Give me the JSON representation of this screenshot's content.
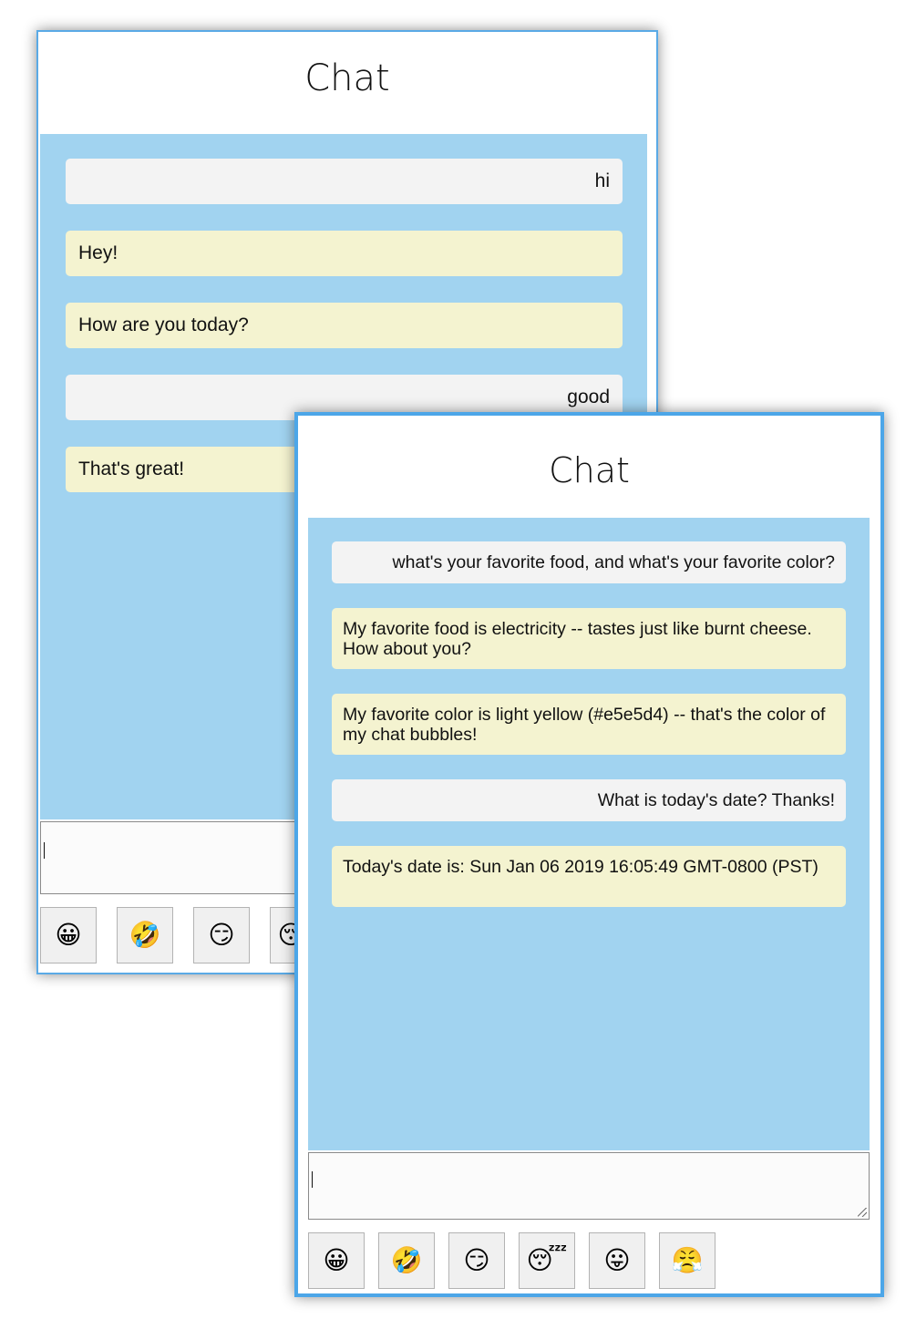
{
  "back_window": {
    "title": "Chat",
    "messages": [
      {
        "from": "user",
        "text": "hi"
      },
      {
        "from": "bot",
        "text": "Hey!"
      },
      {
        "from": "bot",
        "text": "How are you today?"
      },
      {
        "from": "user",
        "text": "good"
      },
      {
        "from": "bot",
        "text": "That's great!"
      }
    ],
    "input_value": "",
    "emoji_buttons": [
      "😀",
      "🤣",
      "😏",
      "😴"
    ]
  },
  "front_window": {
    "title": "Chat",
    "messages": [
      {
        "from": "user",
        "text": "what's your favorite food, and what's your favorite color?"
      },
      {
        "from": "bot",
        "text": "My favorite food is electricity -- tastes just like burnt cheese. How about you?"
      },
      {
        "from": "bot",
        "text": "My favorite color is light yellow (#e5e5d4) -- that's the color of my chat bubbles!"
      },
      {
        "from": "user",
        "text": "What is today's date? Thanks!"
      },
      {
        "from": "bot",
        "text": "Today's date is: Sun Jan 06 2019 16:05:49 GMT-0800 (PST)"
      }
    ],
    "input_value": "",
    "emoji_buttons": [
      "😀",
      "🤣",
      "😏",
      "😴",
      "😛",
      "😤"
    ]
  },
  "colors": {
    "chat_background": "#a1d3f0",
    "bot_bubble": "#f4f3d0",
    "user_bubble": "#f3f3f3",
    "window_border": "#4ca6e8"
  }
}
